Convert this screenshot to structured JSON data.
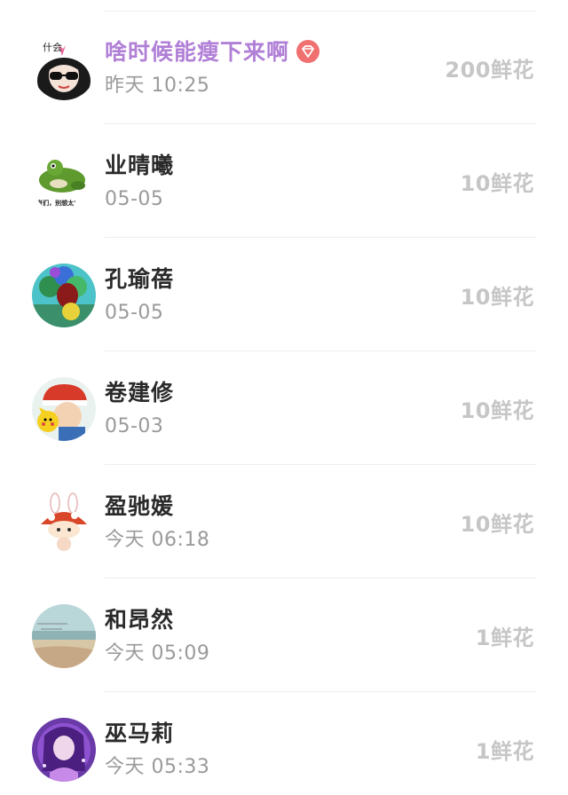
{
  "records": [
    {
      "name": "啥时候能瘦下来啊",
      "time": "昨天 10:25",
      "flowers": "200鲜花",
      "vip": true,
      "avatar_icon": "masked-girl-avatar-icon",
      "avatar_text": "什会"
    },
    {
      "name": "业晴曦",
      "time": "05-05",
      "flowers": "10鲜花",
      "vip": false,
      "avatar_icon": "green-frog-meme-avatar-icon",
      "avatar_text": "'崽们，别想太'"
    },
    {
      "name": "孔瑜蓓",
      "time": "05-05",
      "flowers": "10鲜花",
      "vip": false,
      "avatar_icon": "balloons-avatar-icon"
    },
    {
      "name": "卷建修",
      "time": "05-03",
      "flowers": "10鲜花",
      "vip": false,
      "avatar_icon": "pikachu-trainer-avatar-icon"
    },
    {
      "name": "盈驰媛",
      "time": "今天 06:18",
      "flowers": "10鲜花",
      "vip": false,
      "avatar_icon": "bunny-mushroom-avatar-icon"
    },
    {
      "name": "和昂然",
      "time": "今天 05:09",
      "flowers": "1鲜花",
      "vip": false,
      "avatar_icon": "beach-landscape-avatar-icon"
    },
    {
      "name": "巫马莉",
      "time": "今天 05:33",
      "flowers": "1鲜花",
      "vip": false,
      "avatar_icon": "purple-anime-girl-avatar-icon"
    }
  ],
  "colors": {
    "vip_name": "#b07fd6",
    "vip_badge": "#f07070",
    "name": "#2a2a2a",
    "time": "#9a9a9a",
    "flowers": "#c6c6c6",
    "divider": "#eeeeee"
  }
}
